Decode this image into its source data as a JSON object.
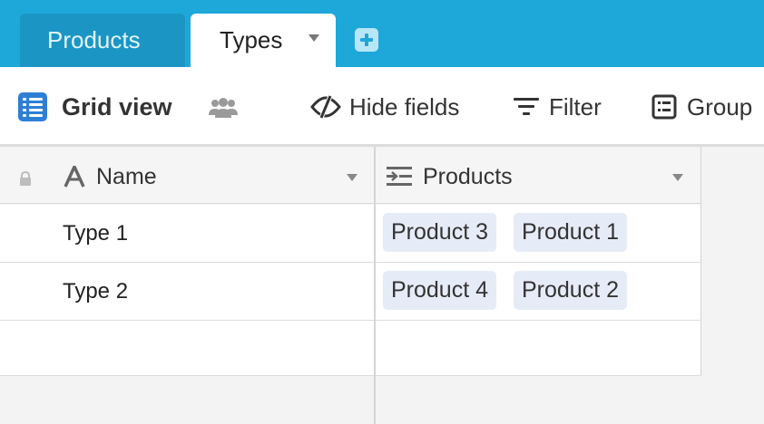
{
  "tabs": [
    {
      "label": "Products",
      "active": false
    },
    {
      "label": "Types",
      "active": true
    }
  ],
  "toolbar": {
    "view_label": "Grid view",
    "hide_fields_label": "Hide fields",
    "filter_label": "Filter",
    "group_label": "Group"
  },
  "grid": {
    "columns": [
      {
        "label": "Name",
        "icon": "text-a-icon"
      },
      {
        "label": "Products",
        "icon": "linked-records-icon"
      }
    ],
    "rows": [
      {
        "name": "Type 1",
        "products": [
          "Product 3",
          "Product 1"
        ]
      },
      {
        "name": "Type 2",
        "products": [
          "Product 4",
          "Product 2"
        ]
      }
    ]
  },
  "colors": {
    "tab_bar": "#1ea7d9",
    "grid_view_icon": "#2d7fd6",
    "chip": "#e6ecf7"
  }
}
